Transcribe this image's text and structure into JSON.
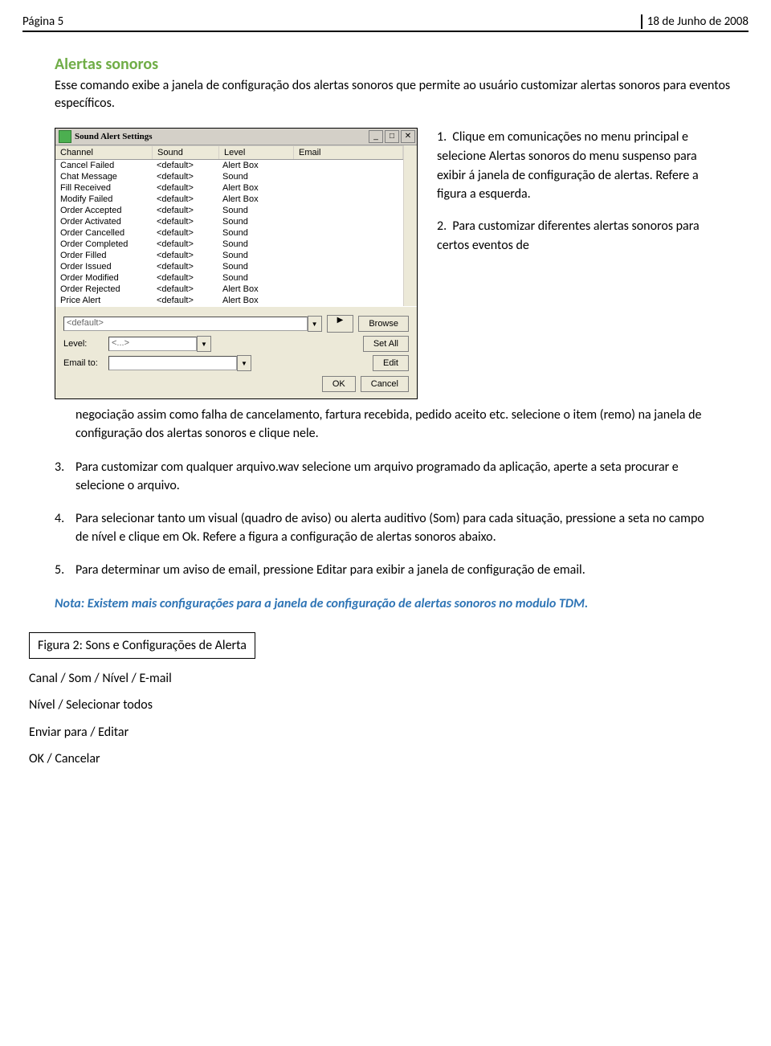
{
  "header": {
    "left": "Página 5",
    "right": "18 de Junho de 2008"
  },
  "h1": "Alertas sonoros",
  "intro": "Esse comando exibe a janela de configuração dos alertas sonoros que permite ao usuário customizar alertas sonoros para eventos específicos.",
  "win": {
    "title": "Sound Alert Settings",
    "min": "_",
    "max": "□",
    "close": "✕",
    "cols": [
      "Channel",
      "Sound",
      "Level",
      "Email"
    ],
    "rows": [
      [
        "Cancel Failed",
        "<default>",
        "Alert Box",
        ""
      ],
      [
        "Chat Message",
        "<default>",
        "Sound",
        ""
      ],
      [
        "Fill Received",
        "<default>",
        "Alert Box",
        ""
      ],
      [
        "Modify Failed",
        "<default>",
        "Alert Box",
        ""
      ],
      [
        "Order Accepted",
        "<default>",
        "Sound",
        ""
      ],
      [
        "Order Activated",
        "<default>",
        "Sound",
        ""
      ],
      [
        "Order Cancelled",
        "<default>",
        "Sound",
        ""
      ],
      [
        "Order Completed",
        "<default>",
        "Sound",
        ""
      ],
      [
        "Order Filled",
        "<default>",
        "Sound",
        ""
      ],
      [
        "Order Issued",
        "<default>",
        "Sound",
        ""
      ],
      [
        "Order Modified",
        "<default>",
        "Sound",
        ""
      ],
      [
        "Order Rejected",
        "<default>",
        "Alert Box",
        ""
      ],
      [
        "Price Alert",
        "<default>",
        "Alert Box",
        ""
      ]
    ],
    "soundSel": "<default>",
    "arrow": "▶",
    "browse": "Browse",
    "levelLbl": "Level:",
    "levelVal": "<...>",
    "setAll": "Set All",
    "emailLbl": "Email to:",
    "edit": "Edit",
    "ok": "OK",
    "cancel": "Cancel",
    "dd": "▼"
  },
  "steps": {
    "1": "Clique em comunicações no menu principal e selecione Alertas sonoros do menu suspenso para exibir á janela de configuração de alertas. Refere a figura a esquerda.",
    "2a": "Para customizar diferentes alertas sonoros para certos eventos de",
    "2b": "negociação assim como falha de cancelamento, fartura recebida, pedido aceito etc. selecione o item (remo) na janela de configuração dos alertas sonoros e clique nele.",
    "3": "Para customizar com qualquer arquivo.wav selecione um arquivo programado da aplicação, aperte a seta procurar e selecione o arquivo.",
    "4": "Para selecionar tanto um visual (quadro de aviso) ou alerta auditivo (Som) para cada situação, pressione a seta no campo de nível e clique em Ok. Refere a figura a configuração de alertas sonoros abaixo.",
    "5": "Para determinar um aviso de email, pressione Editar para exibir a janela de configuração de email."
  },
  "note": "Nota: Existem mais configurações para a janela de configuração de alertas sonoros no modulo TDM.",
  "figcap": {
    "label": "Figura 2",
    "text": ": Sons e Configurações de Alerta"
  },
  "tail": {
    "l1": "Canal / Som / Nível / E-mail",
    "l2": "Nível / Selecionar todos",
    "l3": "Enviar para / Editar",
    "l4": "OK / Cancelar"
  }
}
